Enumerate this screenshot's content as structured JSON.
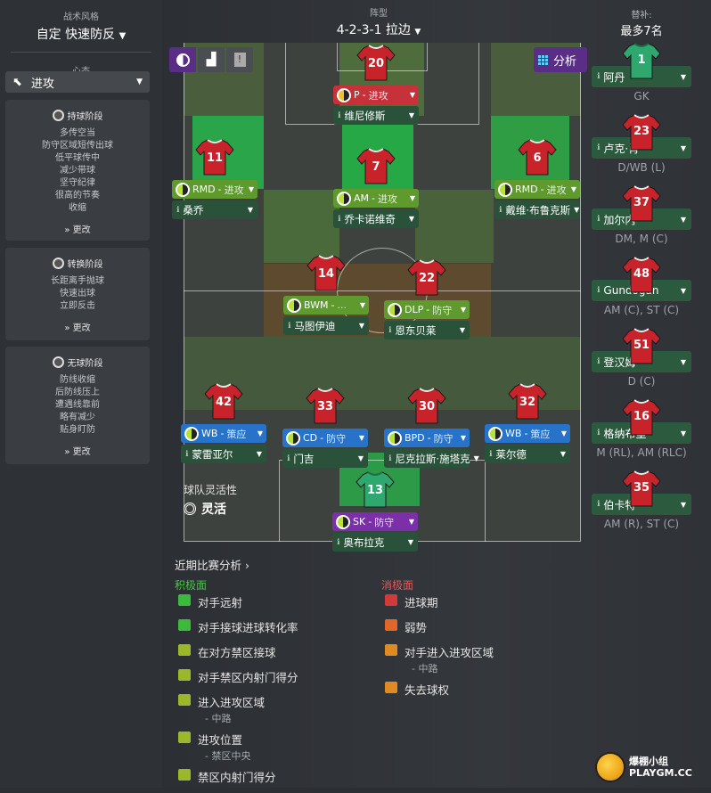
{
  "sidebar": {
    "style_label": "战术风格",
    "style_value": "自定 快速防反",
    "mentality_label": "心态",
    "mentality_value": "进攻",
    "in_possession": {
      "title": "持球阶段",
      "lines": [
        "多传空当",
        "防守区域短传出球",
        "低平球传中",
        "减少带球",
        "坚守纪律",
        "很高的节奏",
        "收缩"
      ],
      "more": "更改"
    },
    "transition": {
      "title": "转换阶段",
      "lines": [
        "长距离手抛球",
        "快速出球",
        "立即反击"
      ],
      "more": "更改"
    },
    "out_possession": {
      "title": "无球阶段",
      "lines": [
        "防线收缩",
        "后防线压上",
        "遭遇线靠前",
        "略有减少",
        "贴身盯防"
      ],
      "more": "更改"
    }
  },
  "formation": {
    "label": "阵型",
    "value": "4-2-3-1 拉边"
  },
  "toolbar": {
    "analysis_label": "分析"
  },
  "players": [
    {
      "num": "20",
      "role": "P",
      "duty": "进攻",
      "name": "维尼修斯",
      "role_color": "#c6313a"
    },
    {
      "num": "11",
      "role": "RMD",
      "duty": "进攻",
      "name": "桑乔",
      "role_color": "#5e9a2e"
    },
    {
      "num": "7",
      "role": "AM",
      "duty": "进攻",
      "name": "乔卡诺维奇",
      "role_color": "#5e9a2e"
    },
    {
      "num": "6",
      "role": "RMD",
      "duty": "进攻",
      "name": "戴维·布鲁克斯",
      "role_color": "#5e9a2e"
    },
    {
      "num": "14",
      "role": "BWM",
      "duty": "...",
      "name": "马图伊迪",
      "role_color": "#5e9a2e"
    },
    {
      "num": "22",
      "role": "DLP",
      "duty": "防守",
      "name": "恩东贝莱",
      "role_color": "#5e9a2e"
    },
    {
      "num": "42",
      "role": "WB",
      "duty": "策应",
      "name": "蒙雷亚尔",
      "role_color": "#2673c9"
    },
    {
      "num": "33",
      "role": "CD",
      "duty": "防守",
      "name": "门吉",
      "role_color": "#2673c9"
    },
    {
      "num": "30",
      "role": "BPD",
      "duty": "防守",
      "name": "尼克拉斯·施塔克",
      "role_color": "#2673c9"
    },
    {
      "num": "32",
      "role": "WB",
      "duty": "策应",
      "name": "莱尔德",
      "role_color": "#2673c9"
    },
    {
      "num": "13",
      "role": "SK",
      "duty": "防守",
      "name": "奥布拉克",
      "role_color": "#7b2fa8"
    }
  ],
  "team_fluidity": {
    "label": "球队灵活性",
    "value": "灵活"
  },
  "subs": {
    "label": "替补:",
    "limit": "最多7名",
    "list": [
      {
        "num": "1",
        "name": "阿丹",
        "pos": "GK"
      },
      {
        "num": "23",
        "name": "卢克·肖",
        "pos": "D/WB (L)"
      },
      {
        "num": "37",
        "name": "加尔内",
        "pos": "DM, M (C)"
      },
      {
        "num": "48",
        "name": "Gundogan",
        "pos": "AM (C), ST (C)"
      },
      {
        "num": "51",
        "name": "登汉姆",
        "pos": "D (C)"
      },
      {
        "num": "16",
        "name": "格纳布里",
        "pos": "M (RL), AM (RLC)"
      },
      {
        "num": "35",
        "name": "伯卡特",
        "pos": "AM (R), ST (C)"
      }
    ]
  },
  "analysis": {
    "title": "近期比赛分析 ›",
    "positives_label": "积极面",
    "negatives_label": "消极面",
    "positives": [
      {
        "text": "对手远射",
        "sub": "",
        "color": "#3cba3c"
      },
      {
        "text": "对手接球进球转化率",
        "sub": "",
        "color": "#3cba3c"
      },
      {
        "text": "在对方禁区接球",
        "sub": "",
        "color": "#9bb82a"
      },
      {
        "text": "对手禁区内射门得分",
        "sub": "",
        "color": "#9bb82a"
      },
      {
        "text": "进入进攻区域",
        "sub": "- 中路",
        "color": "#9bb82a"
      },
      {
        "text": "进攻位置",
        "sub": "- 禁区中央",
        "color": "#9bb82a"
      },
      {
        "text": "禁区内射门得分",
        "sub": "",
        "color": "#9bb82a"
      }
    ],
    "negatives": [
      {
        "text": "进球期",
        "sub": "",
        "color": "#d23a3a"
      },
      {
        "text": "弱势",
        "sub": "",
        "color": "#e0662a"
      },
      {
        "text": "对手进入进攻区域",
        "sub": "- 中路",
        "color": "#e08a22"
      },
      {
        "text": "失去球权",
        "sub": "",
        "color": "#e08a22"
      }
    ]
  },
  "watermark": "爆棚小组 PLAYGM.CC"
}
